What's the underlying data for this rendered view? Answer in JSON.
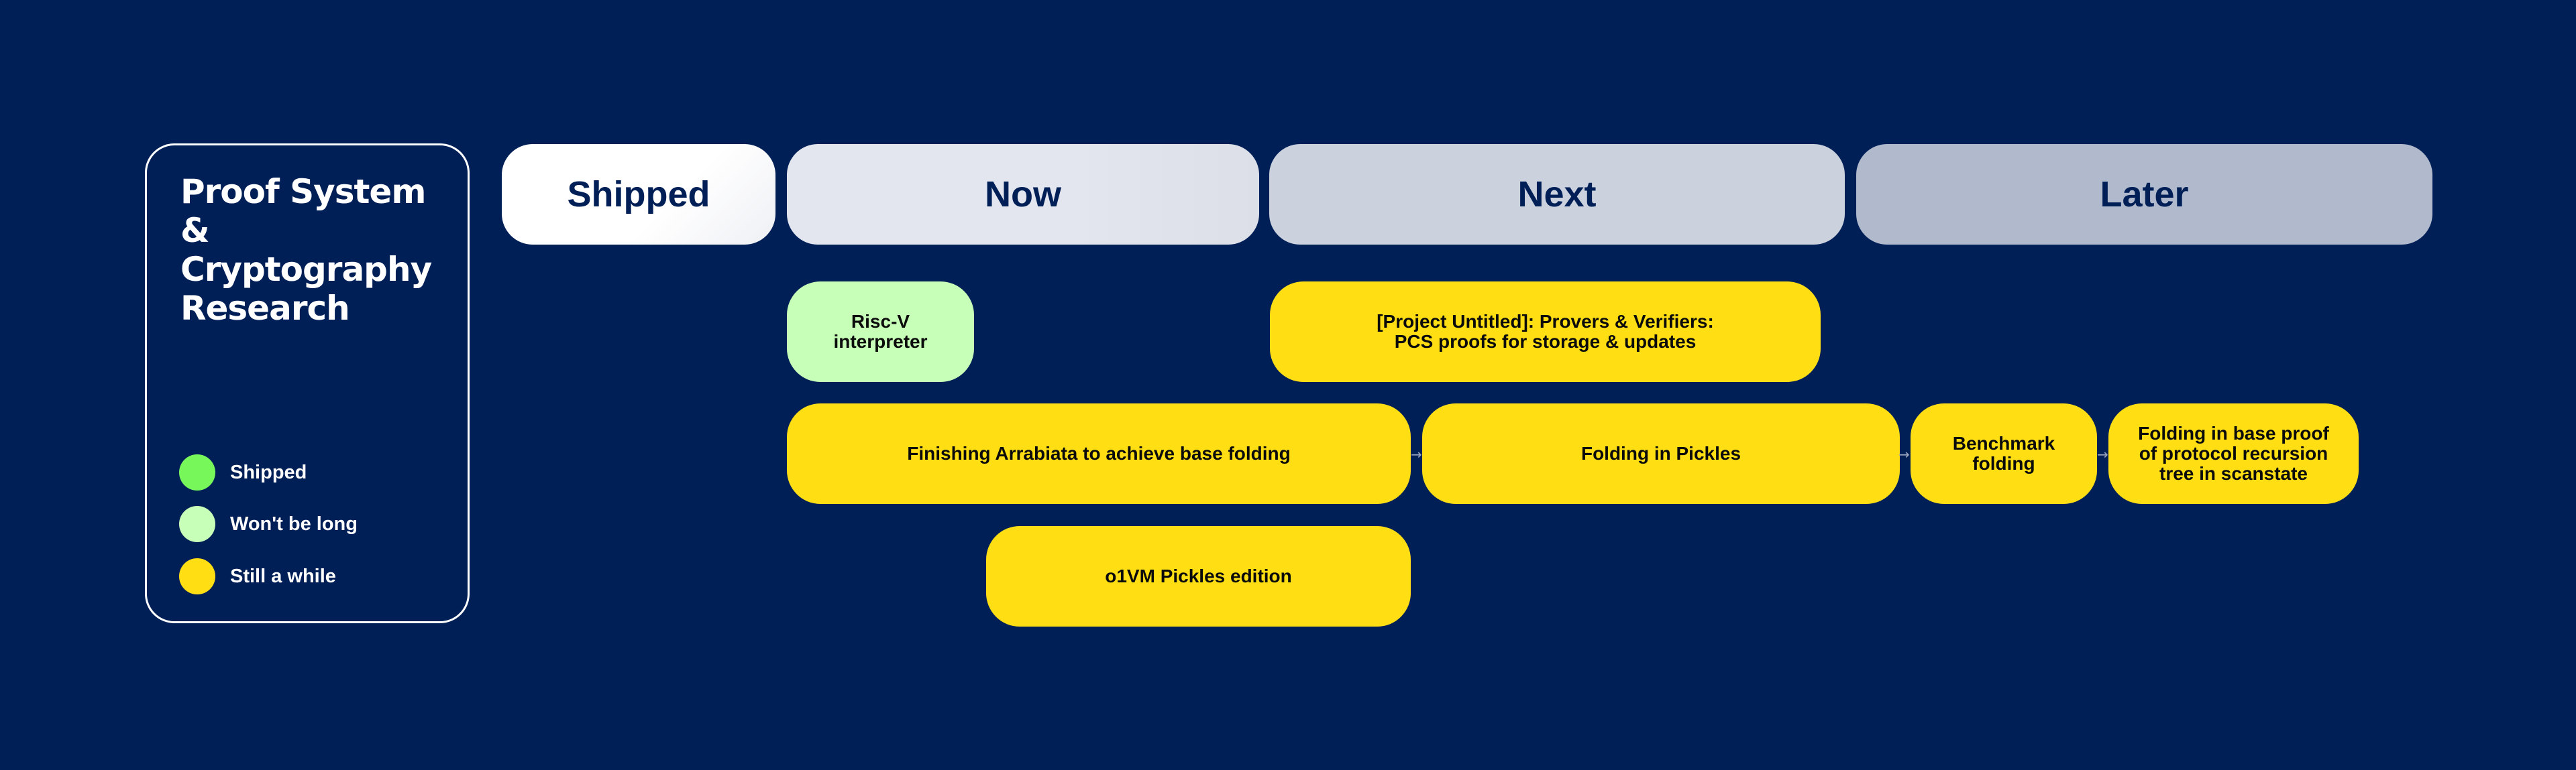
{
  "legend": {
    "title": "Proof System & Cryptography Research",
    "items": [
      {
        "label": "Shipped",
        "color": "#77f75a"
      },
      {
        "label": "Won't be long",
        "color": "#c8ffb8"
      },
      {
        "label": "Still a while",
        "color": "#ffdf14"
      }
    ]
  },
  "columns": [
    {
      "label": "Shipped",
      "bg": "linear-gradient(135deg,#ffffff 60%,#eef0f4 100%)"
    },
    {
      "label": "Now",
      "bg": "linear-gradient(90deg,#e3e6ee 60%,#dcdfe8 100%)"
    },
    {
      "label": "Next",
      "bg": "#cbd1dd"
    },
    {
      "label": "Later",
      "bg": "#b1bacc"
    }
  ],
  "cards": [
    {
      "label": "Risc-V interpreter",
      "status": "Won't be long",
      "color": "#c8ffb8",
      "column": "Now"
    },
    {
      "label": "[Project Untitled]: Provers & Verifiers: PCS proofs for storage & updates",
      "status": "Still a while",
      "color": "#ffdf14",
      "column": "Next"
    },
    {
      "label": "Finishing Arrabiata to achieve base folding",
      "status": "Still a while",
      "color": "#ffdf14",
      "column": "Now"
    },
    {
      "label": "Folding in Pickles",
      "status": "Still a while",
      "color": "#ffdf14",
      "column": "Next"
    },
    {
      "label": "Benchmark folding",
      "status": "Still a while",
      "color": "#ffdf14",
      "column": "Later"
    },
    {
      "label": "Folding in base proof of protocol recursion tree in scanstate",
      "status": "Still a while",
      "color": "#ffdf14",
      "column": "Later"
    },
    {
      "label": "o1VM Pickles edition",
      "status": "Still a while",
      "color": "#ffdf14",
      "column": "Now"
    }
  ],
  "arrow_glyph": "→"
}
